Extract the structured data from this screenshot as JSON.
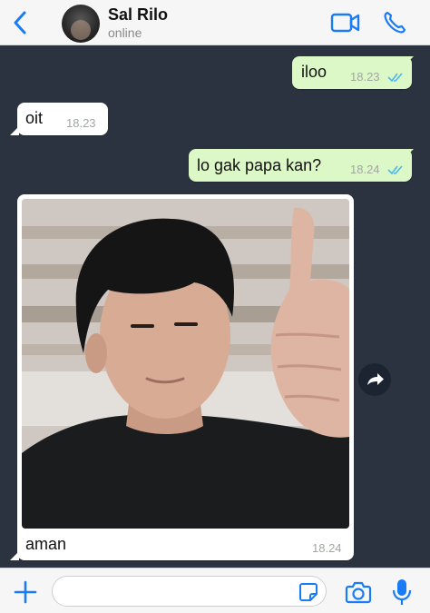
{
  "header": {
    "contact_name": "Sal Rilo",
    "status": "online",
    "icons": [
      "back-chevron-icon",
      "video-call-icon",
      "phone-icon"
    ],
    "accent_color": "#1a7cf5"
  },
  "messages": [
    {
      "direction": "outgoing",
      "text": "iloo",
      "time": "18.23",
      "read": true
    },
    {
      "direction": "incoming",
      "text": "oit",
      "time": "18.23"
    },
    {
      "direction": "outgoing",
      "text": "lo gak papa kan?",
      "time": "18.24",
      "read": true
    },
    {
      "direction": "incoming",
      "type": "photo",
      "caption": "aman",
      "time": "18.24"
    }
  ],
  "input": {
    "placeholder": "",
    "icons": [
      "plus-icon",
      "sticker-icon",
      "camera-icon",
      "microphone-icon"
    ]
  },
  "colors": {
    "chat_background": "#2c3340",
    "outgoing_bubble": "#dcf8c6",
    "incoming_bubble": "#ffffff",
    "read_ticks": "#4fb6ec"
  }
}
